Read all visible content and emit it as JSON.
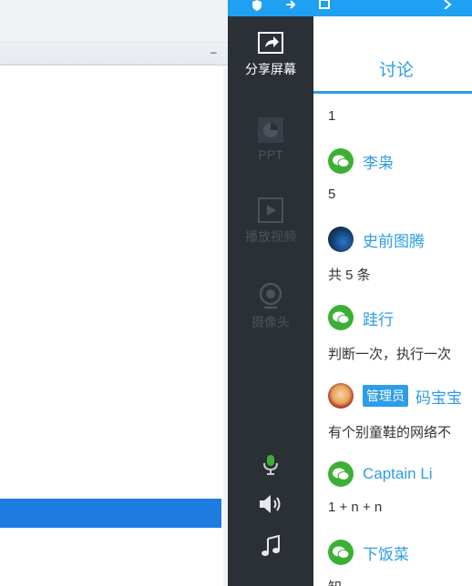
{
  "toolbar": {
    "items": [
      {
        "label": "分享屏幕",
        "icon": "share-screen-icon",
        "active": true
      },
      {
        "label": "PPT",
        "icon": "ppt-pie-icon",
        "active": false
      },
      {
        "label": "播放视频",
        "icon": "play-video-icon",
        "active": false
      },
      {
        "label": "摄像头",
        "icon": "webcam-icon",
        "active": false
      }
    ],
    "bottom_icons": [
      "microphone-icon",
      "speaker-icon",
      "music-note-icon"
    ]
  },
  "tabs": {
    "discuss": "讨论"
  },
  "feed": [
    {
      "type": "message",
      "text": "1"
    },
    {
      "type": "user",
      "avatar": "wechat",
      "name": "李枭"
    },
    {
      "type": "message",
      "text": "5"
    },
    {
      "type": "user",
      "avatar": "dino",
      "name": "史前图腾"
    },
    {
      "type": "message",
      "text": "共 5 条"
    },
    {
      "type": "user",
      "avatar": "wechat",
      "name": "跬行"
    },
    {
      "type": "message",
      "text": "判断一次，执行一次"
    },
    {
      "type": "user",
      "avatar": "cartoon",
      "badge": "管理员",
      "name": "码宝宝"
    },
    {
      "type": "message",
      "text": "有个别童鞋的网络不"
    },
    {
      "type": "user",
      "avatar": "wechat",
      "name": "Captain Li"
    },
    {
      "type": "message",
      "text": "1 + n + n"
    },
    {
      "type": "user",
      "avatar": "wechat",
      "name": "下饭菜"
    },
    {
      "type": "message",
      "text": "知"
    }
  ],
  "colors": {
    "accent": "#2d9de6",
    "toolbar_bg": "#2b2f36",
    "topbar": "#1fa0f2",
    "wechat_green": "#3cb034",
    "left_selection": "#1e7be0"
  }
}
